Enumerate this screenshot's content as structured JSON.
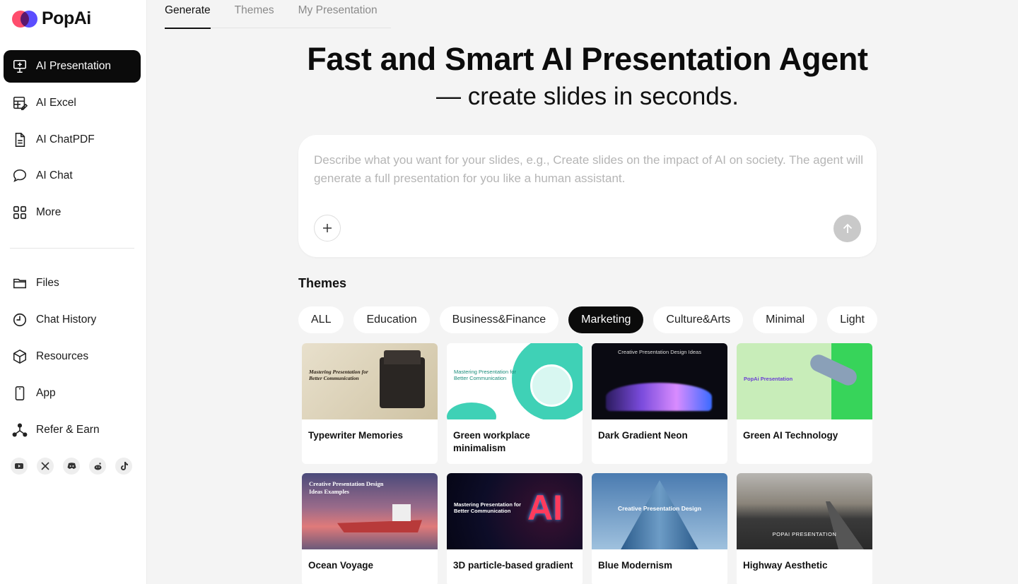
{
  "brand": {
    "name": "PopAi"
  },
  "sidebar": {
    "main": [
      {
        "label": "AI Presentation",
        "icon": "presentation-icon"
      },
      {
        "label": "AI Excel",
        "icon": "excel-icon"
      },
      {
        "label": "AI ChatPDF",
        "icon": "document-icon"
      },
      {
        "label": "AI Chat",
        "icon": "chat-bubble-icon"
      },
      {
        "label": "More",
        "icon": "grid-icon"
      }
    ],
    "secondary": [
      {
        "label": "Files",
        "icon": "folder-icon"
      },
      {
        "label": "Chat History",
        "icon": "clock-icon"
      },
      {
        "label": "Resources",
        "icon": "box-icon"
      },
      {
        "label": "App",
        "icon": "phone-icon"
      },
      {
        "label": "Refer & Earn",
        "icon": "share-icon"
      }
    ],
    "socials": [
      "youtube-icon",
      "x-icon",
      "discord-icon",
      "reddit-icon",
      "tiktok-icon"
    ]
  },
  "tabs": [
    "Generate",
    "Themes",
    "My Presentation"
  ],
  "hero": {
    "title": "Fast and Smart AI Presentation Agent",
    "subtitle": "— create slides in seconds."
  },
  "prompt": {
    "placeholder": "Describe what you want for your slides, e.g., Create slides on the impact of AI on society. The agent will generate a full presentation for you like a human assistant."
  },
  "themes": {
    "title": "Themes",
    "chips": [
      "ALL",
      "Education",
      "Business&Finance",
      "Marketing",
      "Culture&Arts",
      "Minimal",
      "Light"
    ],
    "selected": "Marketing",
    "cards": [
      {
        "name": "Typewriter Memories",
        "thumb_text": "Mastering Presentation for Better Communication"
      },
      {
        "name": "Green workplace minimalism",
        "thumb_text": "Mastering Presentation for Better Communication"
      },
      {
        "name": "Dark Gradient Neon",
        "thumb_text": "Creative Presentation Design Ideas"
      },
      {
        "name": "Green AI Technology",
        "thumb_text": "PopAi Presentation"
      },
      {
        "name": "Ocean Voyage",
        "thumb_text": "Creative Presentation Design Ideas Examples"
      },
      {
        "name": "3D particle-based gradient",
        "thumb_text": "Mastering Presentation for Better Communication"
      },
      {
        "name": "Blue Modernism",
        "thumb_text": "Creative Presentation Design"
      },
      {
        "name": "Highway Aesthetic",
        "thumb_text": "POPAI PRESENTATION"
      }
    ]
  },
  "colors": {
    "active_bg": "#0b0b0b",
    "page_bg": "#f4f4f4",
    "send_disabled": "#c9c9c9"
  }
}
